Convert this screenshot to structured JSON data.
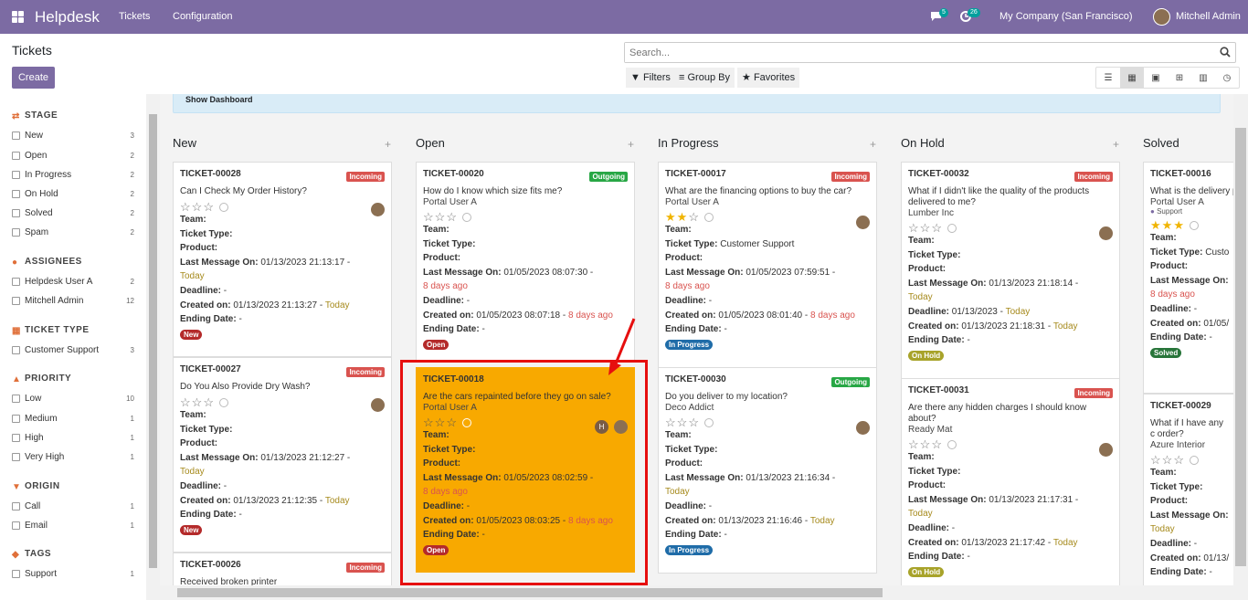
{
  "nav": {
    "brand": "Helpdesk",
    "menu": [
      "Tickets",
      "Configuration"
    ],
    "chat_count": "5",
    "activity_count": "26",
    "company": "My Company (San Francisco)",
    "user": "Mitchell Admin"
  },
  "control": {
    "title": "Tickets",
    "create_label": "Create",
    "search_placeholder": "Search...",
    "filters_label": "Filters",
    "groupby_label": "Group By",
    "favorites_label": "Favorites"
  },
  "sidebar": {
    "stage": {
      "title": "STAGE",
      "items": [
        {
          "label": "New",
          "count": "3"
        },
        {
          "label": "Open",
          "count": "2"
        },
        {
          "label": "In Progress",
          "count": "2"
        },
        {
          "label": "On Hold",
          "count": "2"
        },
        {
          "label": "Solved",
          "count": "2"
        },
        {
          "label": "Spam",
          "count": "2"
        }
      ]
    },
    "assignees": {
      "title": "ASSIGNEES",
      "items": [
        {
          "label": "Helpdesk User A",
          "count": "2"
        },
        {
          "label": "Mitchell Admin",
          "count": "12"
        }
      ]
    },
    "ticket_type": {
      "title": "TICKET TYPE",
      "items": [
        {
          "label": "Customer Support",
          "count": "3"
        }
      ]
    },
    "priority": {
      "title": "PRIORITY",
      "items": [
        {
          "label": "Low",
          "count": "10"
        },
        {
          "label": "Medium",
          "count": "1"
        },
        {
          "label": "High",
          "count": "1"
        },
        {
          "label": "Very High",
          "count": "1"
        }
      ]
    },
    "origin": {
      "title": "ORIGIN",
      "items": [
        {
          "label": "Call",
          "count": "1"
        },
        {
          "label": "Email",
          "count": "1"
        }
      ]
    },
    "tags": {
      "title": "TAGS",
      "items": [
        {
          "label": "Support",
          "count": "1"
        }
      ]
    }
  },
  "dashboard_label": "Show Dashboard",
  "labels": {
    "team": "Team:",
    "ticket_type": "Ticket Type:",
    "product": "Product:",
    "last_message": "Last Message On:",
    "deadline": "Deadline:",
    "created": "Created on:",
    "ending": "Ending Date:",
    "dash": "-",
    "today": "Today",
    "days_ago": "8 days ago",
    "incoming": "Incoming",
    "outgoing": "Outgoing"
  },
  "columns": {
    "new": {
      "title": "New",
      "cards": [
        {
          "id": "TICKET-00028",
          "tag": "Incoming",
          "title": "Can I Check My Order History?",
          "last_msg": "01/13/2023 21:13:17 -",
          "created": "01/13/2023 21:13:27 -",
          "stage": "New"
        },
        {
          "id": "TICKET-00027",
          "tag": "Incoming",
          "title": "Do You Also Provide Dry Wash?",
          "last_msg": "01/13/2023 21:12:27 -",
          "created": "01/13/2023 21:12:35 -",
          "stage": "New"
        },
        {
          "id": "TICKET-00026",
          "tag": "Incoming",
          "title": "Received broken printer"
        }
      ]
    },
    "open": {
      "title": "Open",
      "cards": [
        {
          "id": "TICKET-00020",
          "tag": "Outgoing",
          "title": "How do I know which size fits me?",
          "customer": "Portal User A",
          "last_msg": "01/05/2023 08:07:30 -",
          "created": "01/05/2023 08:07:18 -",
          "stage": "Open"
        },
        {
          "id": "TICKET-00018",
          "title": "Are the cars repainted before they go on sale?",
          "customer": "Portal User A",
          "avatar_letter": "H",
          "last_msg": "01/05/2023 08:02:59 -",
          "created": "01/05/2023 08:03:25 -",
          "stage": "Open"
        }
      ]
    },
    "progress": {
      "title": "In Progress",
      "cards": [
        {
          "id": "TICKET-00017",
          "tag": "Incoming",
          "title": "What are the financing options to buy the car?",
          "customer": "Portal User A",
          "ticket_type": "Customer Support",
          "last_msg": "01/05/2023 07:59:51 -",
          "created": "01/05/2023 08:01:40 -",
          "stage": "In Progress",
          "priority": 2
        },
        {
          "id": "TICKET-00030",
          "tag": "Outgoing",
          "title": "Do you deliver to my location?",
          "customer": "Deco Addict",
          "last_msg": "01/13/2023 21:16:34 -",
          "created": "01/13/2023 21:16:46 -",
          "stage": "In Progress"
        }
      ]
    },
    "hold": {
      "title": "On Hold",
      "cards": [
        {
          "id": "TICKET-00032",
          "tag": "Incoming",
          "title": "What if I didn't like the quality of the products delivered to me?",
          "customer": "Lumber Inc",
          "last_msg": "01/13/2023 21:18:14 -",
          "deadline": "01/13/2023 -",
          "created": "01/13/2023 21:18:31 -",
          "stage": "On Hold"
        },
        {
          "id": "TICKET-00031",
          "tag": "Incoming",
          "title": "Are there any hidden charges I should know about?",
          "customer": "Ready Mat",
          "last_msg": "01/13/2023 21:17:31 -",
          "created": "01/13/2023 21:17:42 -",
          "stage": "On Hold"
        }
      ]
    },
    "solved": {
      "title": "Solved",
      "cards": [
        {
          "id": "TICKET-00016",
          "title": "What is the delivery products?",
          "customer": "Portal User A",
          "tag_label": "Support",
          "ticket_type": "Custo",
          "last_msg": "",
          "created": "01/05/",
          "stage": "Solved",
          "priority": 3
        },
        {
          "id": "TICKET-00029",
          "title": "What if I have any c order?",
          "customer": "Azure Interior",
          "created": "01/13/"
        }
      ]
    }
  },
  "colors": {
    "brand": "#7c6ba3",
    "incoming": "#d9534f",
    "outgoing": "#28a745",
    "highlight": "#f8a900"
  }
}
